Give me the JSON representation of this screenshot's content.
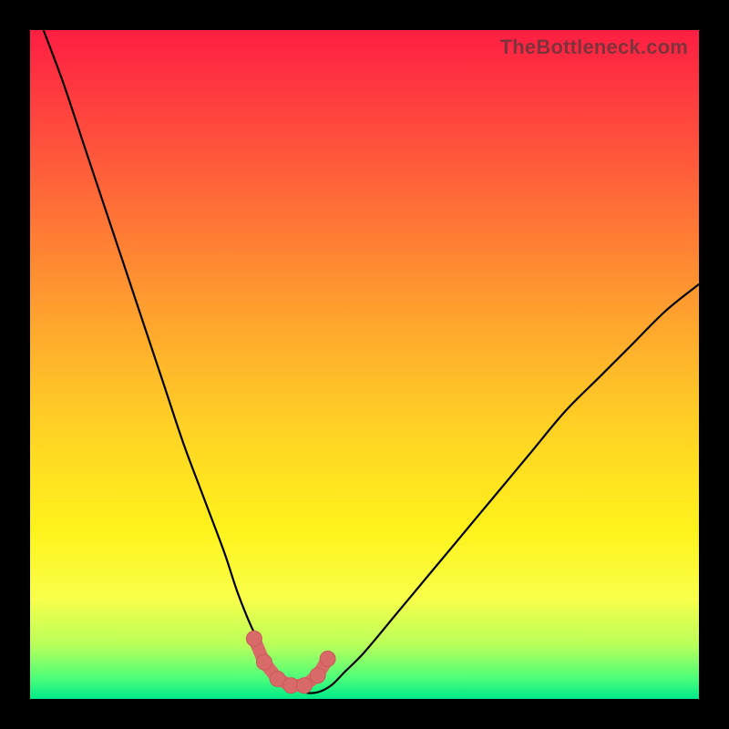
{
  "watermark": "TheBottleneck.com",
  "colors": {
    "curve_stroke": "#000000",
    "marker_fill": "#d96a6a",
    "marker_stroke": "#c95a5a",
    "gradient_top": "#ff1e42",
    "gradient_bottom": "#00e888",
    "frame": "#000000"
  },
  "chart_data": {
    "type": "line",
    "title": "",
    "xlabel": "",
    "ylabel": "",
    "xlim": [
      0,
      100
    ],
    "ylim": [
      0,
      100
    ],
    "grid": false,
    "legend": false,
    "series": [
      {
        "name": "bottleneck-curve",
        "x": [
          2,
          5,
          8,
          11,
          14,
          17,
          20,
          23,
          26,
          29,
          31,
          33,
          35,
          37,
          39,
          41,
          43,
          45,
          47,
          50,
          55,
          60,
          65,
          70,
          75,
          80,
          85,
          90,
          95,
          100
        ],
        "y": [
          100,
          92,
          83,
          74,
          65,
          56,
          47,
          38,
          30,
          22,
          16,
          11,
          7,
          4,
          2,
          1,
          1,
          2,
          4,
          7,
          13,
          19,
          25,
          31,
          37,
          43,
          48,
          53,
          58,
          62
        ]
      }
    ],
    "markers": {
      "name": "trough-markers",
      "x": [
        33.5,
        35,
        37,
        39,
        41,
        43,
        44.5
      ],
      "y": [
        9,
        5.5,
        3,
        2,
        2,
        3.5,
        6
      ]
    }
  }
}
